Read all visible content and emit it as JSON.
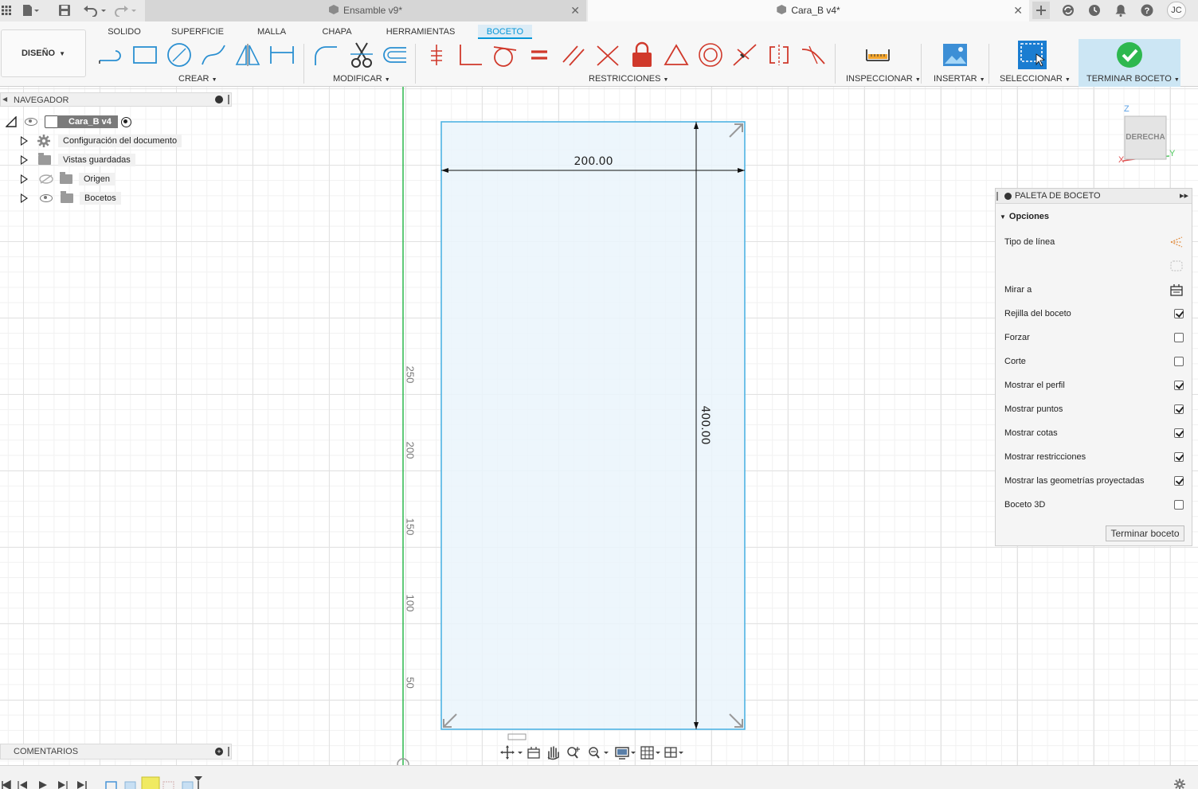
{
  "window": {
    "tabs": [
      {
        "label": "Ensamble v9*",
        "active": false
      },
      {
        "label": "Cara_B v4*",
        "active": true
      }
    ],
    "user_initials": "JC"
  },
  "ribbon": {
    "workspace": "DISEÑO",
    "tabs": [
      "SOLIDO",
      "SUPERFICIE",
      "MALLA",
      "CHAPA",
      "HERRAMIENTAS",
      "BOCETO"
    ],
    "active_tab": "BOCETO",
    "groups": {
      "crear": "CREAR",
      "modificar": "MODIFICAR",
      "restricciones": "RESTRICCIONES",
      "inspeccionar": "INSPECCIONAR",
      "insertar": "INSERTAR",
      "seleccionar": "SELECCIONAR",
      "terminar": "TERMINAR BOCETO"
    }
  },
  "navigator": {
    "title": "NAVEGADOR",
    "root": "Cara_B v4",
    "items": [
      {
        "label": "Configuración del documento",
        "icon": "gear-icon"
      },
      {
        "label": "Vistas guardadas",
        "icon": "folder-icon"
      },
      {
        "label": "Origen",
        "icon": "folder-icon",
        "hidden": true
      },
      {
        "label": "Bocetos",
        "icon": "folder-icon"
      }
    ]
  },
  "comments": {
    "title": "COMENTARIOS"
  },
  "viewport": {
    "view_cube_label": "DERECHA",
    "axes": {
      "z": "Z",
      "x": "X",
      "y": "Y"
    },
    "ruler_ticks": [
      "250",
      "200",
      "150",
      "100",
      "50"
    ],
    "dim_width": "200.00",
    "dim_height": "400.00",
    "colors": {
      "sketch_fill": "#eaf4fb",
      "sketch_edge": "#4fb3e3",
      "axis_green": "#2db84d"
    }
  },
  "palette": {
    "title": "PALETA DE BOCETO",
    "section": "Opciones",
    "rows": [
      {
        "label": "Tipo de línea",
        "control": "icon"
      },
      {
        "label": "",
        "control": "icon"
      },
      {
        "label": "Mirar a",
        "control": "icon"
      },
      {
        "label": "Rejilla del boceto",
        "control": "checkbox",
        "checked": true
      },
      {
        "label": "Forzar",
        "control": "checkbox",
        "checked": false
      },
      {
        "label": "Corte",
        "control": "checkbox",
        "checked": false
      },
      {
        "label": "Mostrar el perfil",
        "control": "checkbox",
        "checked": true
      },
      {
        "label": "Mostrar puntos",
        "control": "checkbox",
        "checked": true
      },
      {
        "label": "Mostrar cotas",
        "control": "checkbox",
        "checked": true
      },
      {
        "label": "Mostrar restricciones",
        "control": "checkbox",
        "checked": true
      },
      {
        "label": "Mostrar las geometrías proyectadas",
        "control": "checkbox",
        "checked": true
      },
      {
        "label": "Boceto 3D",
        "control": "checkbox",
        "checked": false
      }
    ],
    "finish_button": "Terminar boceto"
  }
}
